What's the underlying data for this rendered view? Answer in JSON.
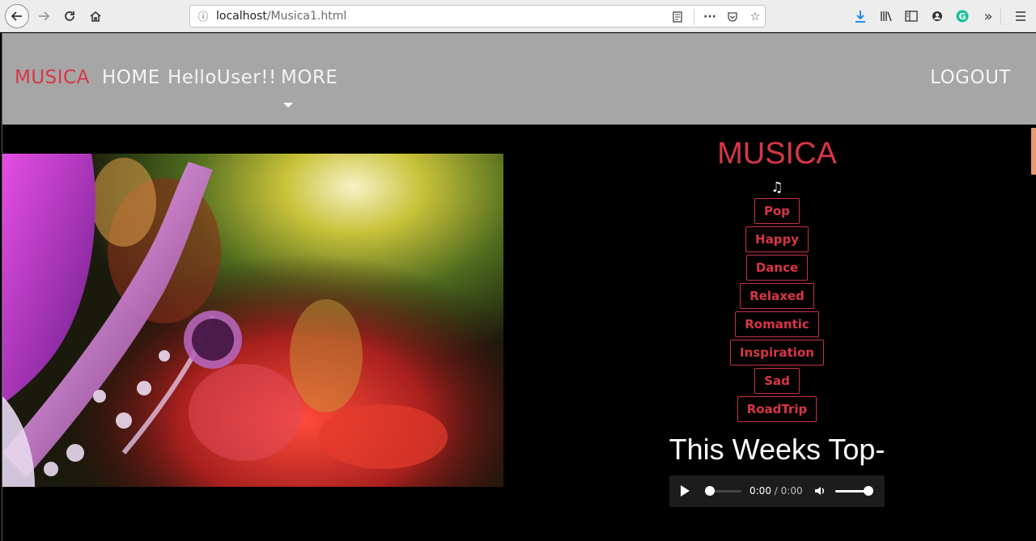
{
  "browser": {
    "url_host": "localhost",
    "url_path": "/Musica1.html"
  },
  "nav": {
    "brand": "MUSICA",
    "home": "HOME",
    "user": "HelloUser!!",
    "more": "MORE",
    "logout": "LOGOUT"
  },
  "sidebar": {
    "title": "MUSICA",
    "note_icon": "music-note-icon",
    "genres": [
      "Pop",
      "Happy",
      "Dance",
      "Relaxed",
      "Romantic",
      "Inspiration",
      "Sad",
      "RoadTrip"
    ]
  },
  "weekly": {
    "heading": "This Weeks Top-"
  },
  "player": {
    "current_time": "0:00",
    "separator": "/",
    "duration": "0:00",
    "progress": 0,
    "volume": 1
  },
  "colors": {
    "accent": "#d93645",
    "navbar": "#a6a6a6",
    "background": "#000000"
  }
}
